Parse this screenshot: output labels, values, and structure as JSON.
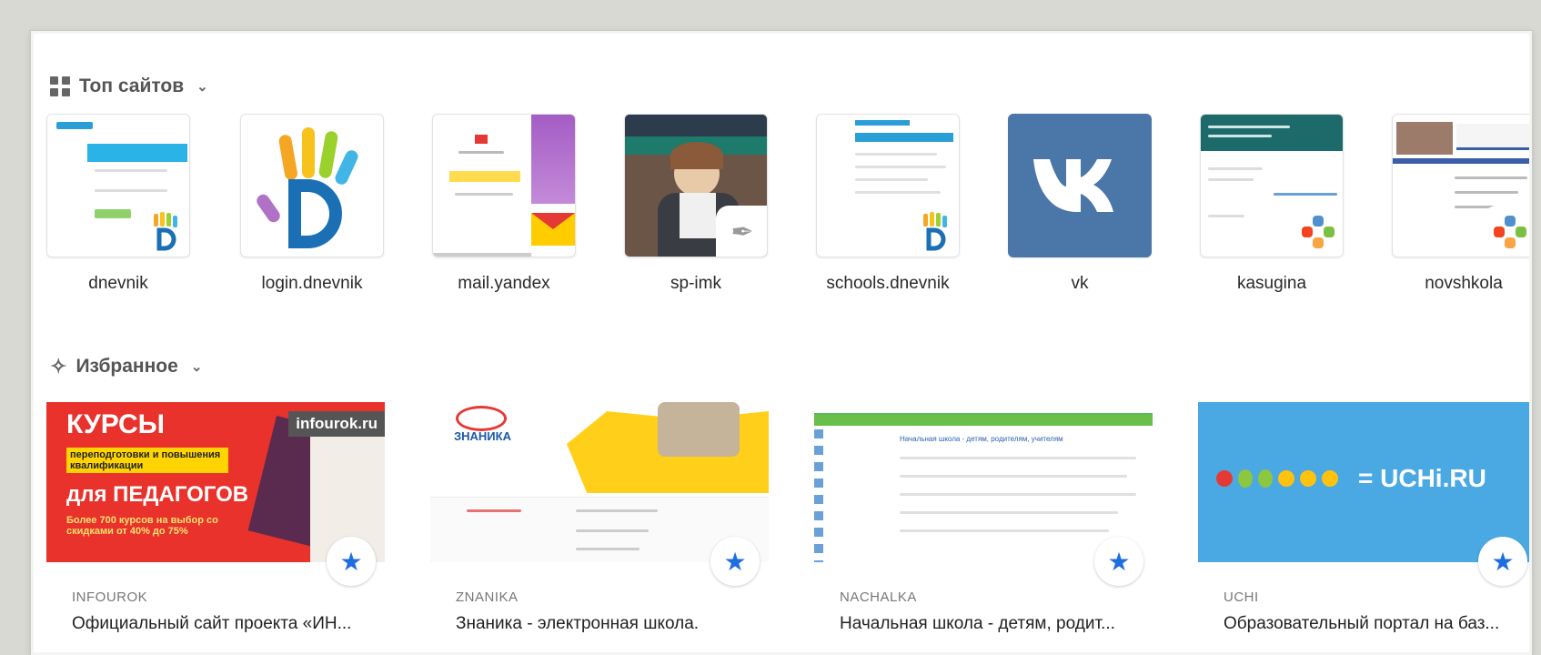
{
  "top_sites": {
    "header": "Топ сайтов",
    "tiles": [
      {
        "label": "dnevnik"
      },
      {
        "label": "login.dnevnik"
      },
      {
        "label": "mail.yandex"
      },
      {
        "label": "sp-imk"
      },
      {
        "label": "schools.dnevnik"
      },
      {
        "label": "vk"
      },
      {
        "label": "kasugina"
      },
      {
        "label": "novshkola"
      }
    ]
  },
  "favorites": {
    "header": "Избранное",
    "cards": [
      {
        "source": "INFOUROK",
        "title": "Официальный сайт проекта «ИН...",
        "thumb_text": "КУРСЫ",
        "thumb_sub": "переподготовки и повышения квалификации",
        "thumb_big": "для ПЕДАГОГОВ",
        "thumb_note": "Более 700 курсов на выбор со скидками от 40% до 75%",
        "thumb_tag": "infourok.ru"
      },
      {
        "source": "ZNANIKA",
        "title": "Знаника - электронная школа.",
        "thumb_text": "ЗНАНИКА"
      },
      {
        "source": "NACHALKA",
        "title": "Начальная школа - детям, родит...",
        "thumb_text": "Начальная школа - детям, родителям, учителям"
      },
      {
        "source": "UCHI",
        "title": "Образовательный портал на баз...",
        "thumb_text": "= UCHi.RU"
      }
    ]
  },
  "colors": {
    "vk": "#4a76a8",
    "star": "#1f6ee0",
    "infourok_red": "#e8322b",
    "uchi_blue": "#4aa9e3"
  }
}
